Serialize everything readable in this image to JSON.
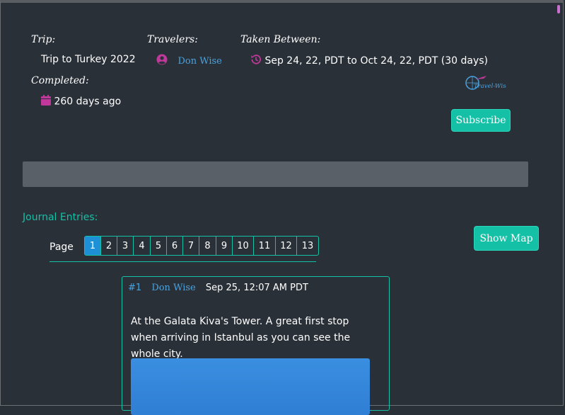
{
  "trip": {
    "label": "Trip:",
    "value": "Trip to Turkey 2022"
  },
  "travelers": {
    "label": "Travelers:",
    "name": "Don Wise",
    "icon": "user-circle-icon"
  },
  "taken_between": {
    "label": "Taken Between:",
    "value": "Sep 24, 22, PDT to Oct 24, 22, PDT (30 days)",
    "icon": "history-icon"
  },
  "completed": {
    "label": "Completed:",
    "value": "260 days ago",
    "icon": "calendar-icon"
  },
  "logo": {
    "text": "Travel-Wise"
  },
  "subscribe_label": "Subscribe",
  "show_map_label": "Show Map",
  "journal": {
    "title": "Journal Entries:",
    "page_label": "Page",
    "pages": [
      "1",
      "2",
      "3",
      "4",
      "5",
      "6",
      "7",
      "8",
      "9",
      "10",
      "11",
      "12",
      "13"
    ],
    "active_page": "1"
  },
  "entry": {
    "number": "#1",
    "author": "Don Wise",
    "date": "Sep 25, 12:07 AM PDT",
    "text": "At the Galata Kiva's Tower. A great first stop when arriving in Istanbul as you can see the whole city."
  },
  "colors": {
    "background": "#2a3038",
    "accent": "#14c0a6",
    "link": "#4aa3df",
    "icon": "#c0399a"
  }
}
